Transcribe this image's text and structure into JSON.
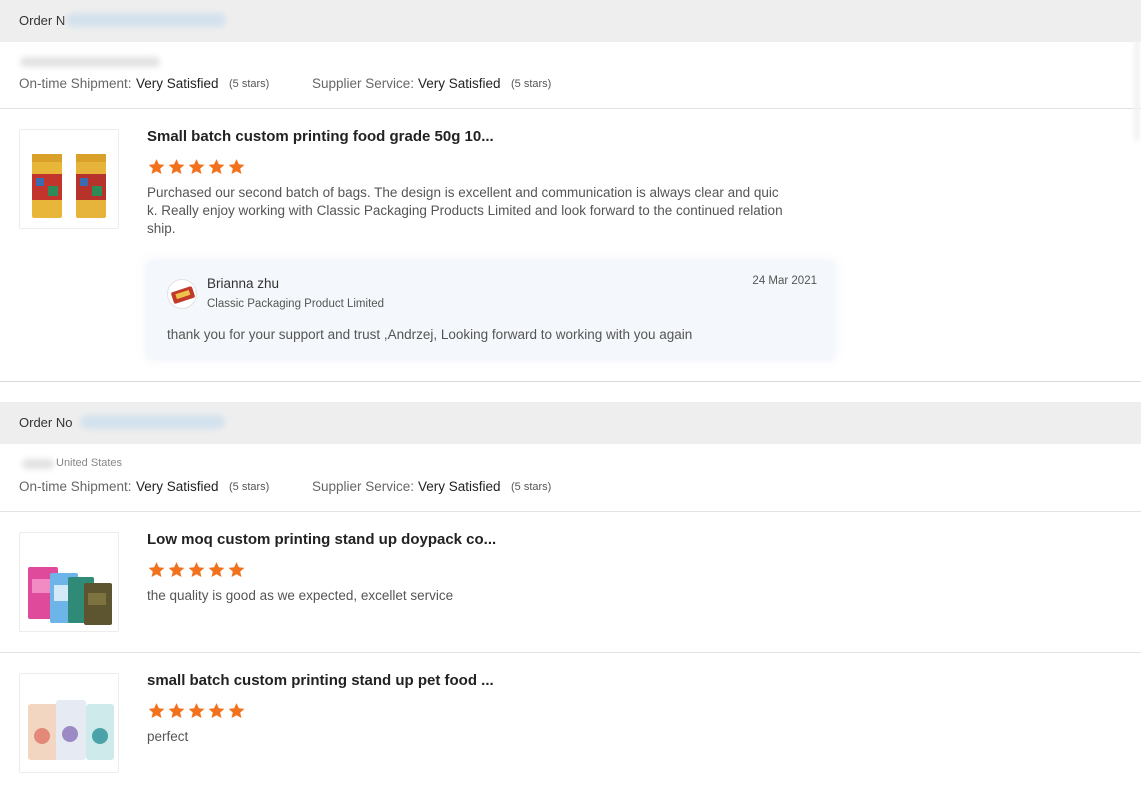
{
  "orders": [
    {
      "order_label": "Order N",
      "metrics": {
        "shipment_label": "On-time Shipment:",
        "shipment_value": "Very Satisfied",
        "shipment_stars": "(5 stars)",
        "service_label": "Supplier Service:",
        "service_value": "Very Satisfied",
        "service_stars": "(5 stars)"
      },
      "items": [
        {
          "title": "Small batch custom printing food grade 50g 10...",
          "rating": 5,
          "review": "Purchased our second batch of bags. The design is excellent and communication is always clear and quic\nk. Really enjoy working with Classic Packaging Products Limited and look forward to the continued relation\nship.",
          "reply": {
            "name": "Brianna zhu",
            "company": "Classic Packaging Product Limited",
            "date": "24 Mar 2021",
            "text": "thank you for your support and trust ,Andrzej, Looking forward to working with you again"
          }
        }
      ]
    },
    {
      "order_label": "Order No",
      "country": "United States",
      "metrics": {
        "shipment_label": "On-time Shipment:",
        "shipment_value": "Very Satisfied",
        "shipment_stars": "(5 stars)",
        "service_label": "Supplier Service:",
        "service_value": "Very Satisfied",
        "service_stars": "(5 stars)"
      },
      "items": [
        {
          "title": "Low moq custom printing stand up doypack co...",
          "rating": 5,
          "review": "the quality is good as we expected, excellet service"
        },
        {
          "title": "small batch custom printing stand up pet food ...",
          "rating": 5,
          "review": "perfect"
        }
      ]
    }
  ],
  "colors": {
    "star": "#f2711c",
    "header_bg": "#eeeeee"
  },
  "icons": {
    "rating": "star-icon"
  }
}
